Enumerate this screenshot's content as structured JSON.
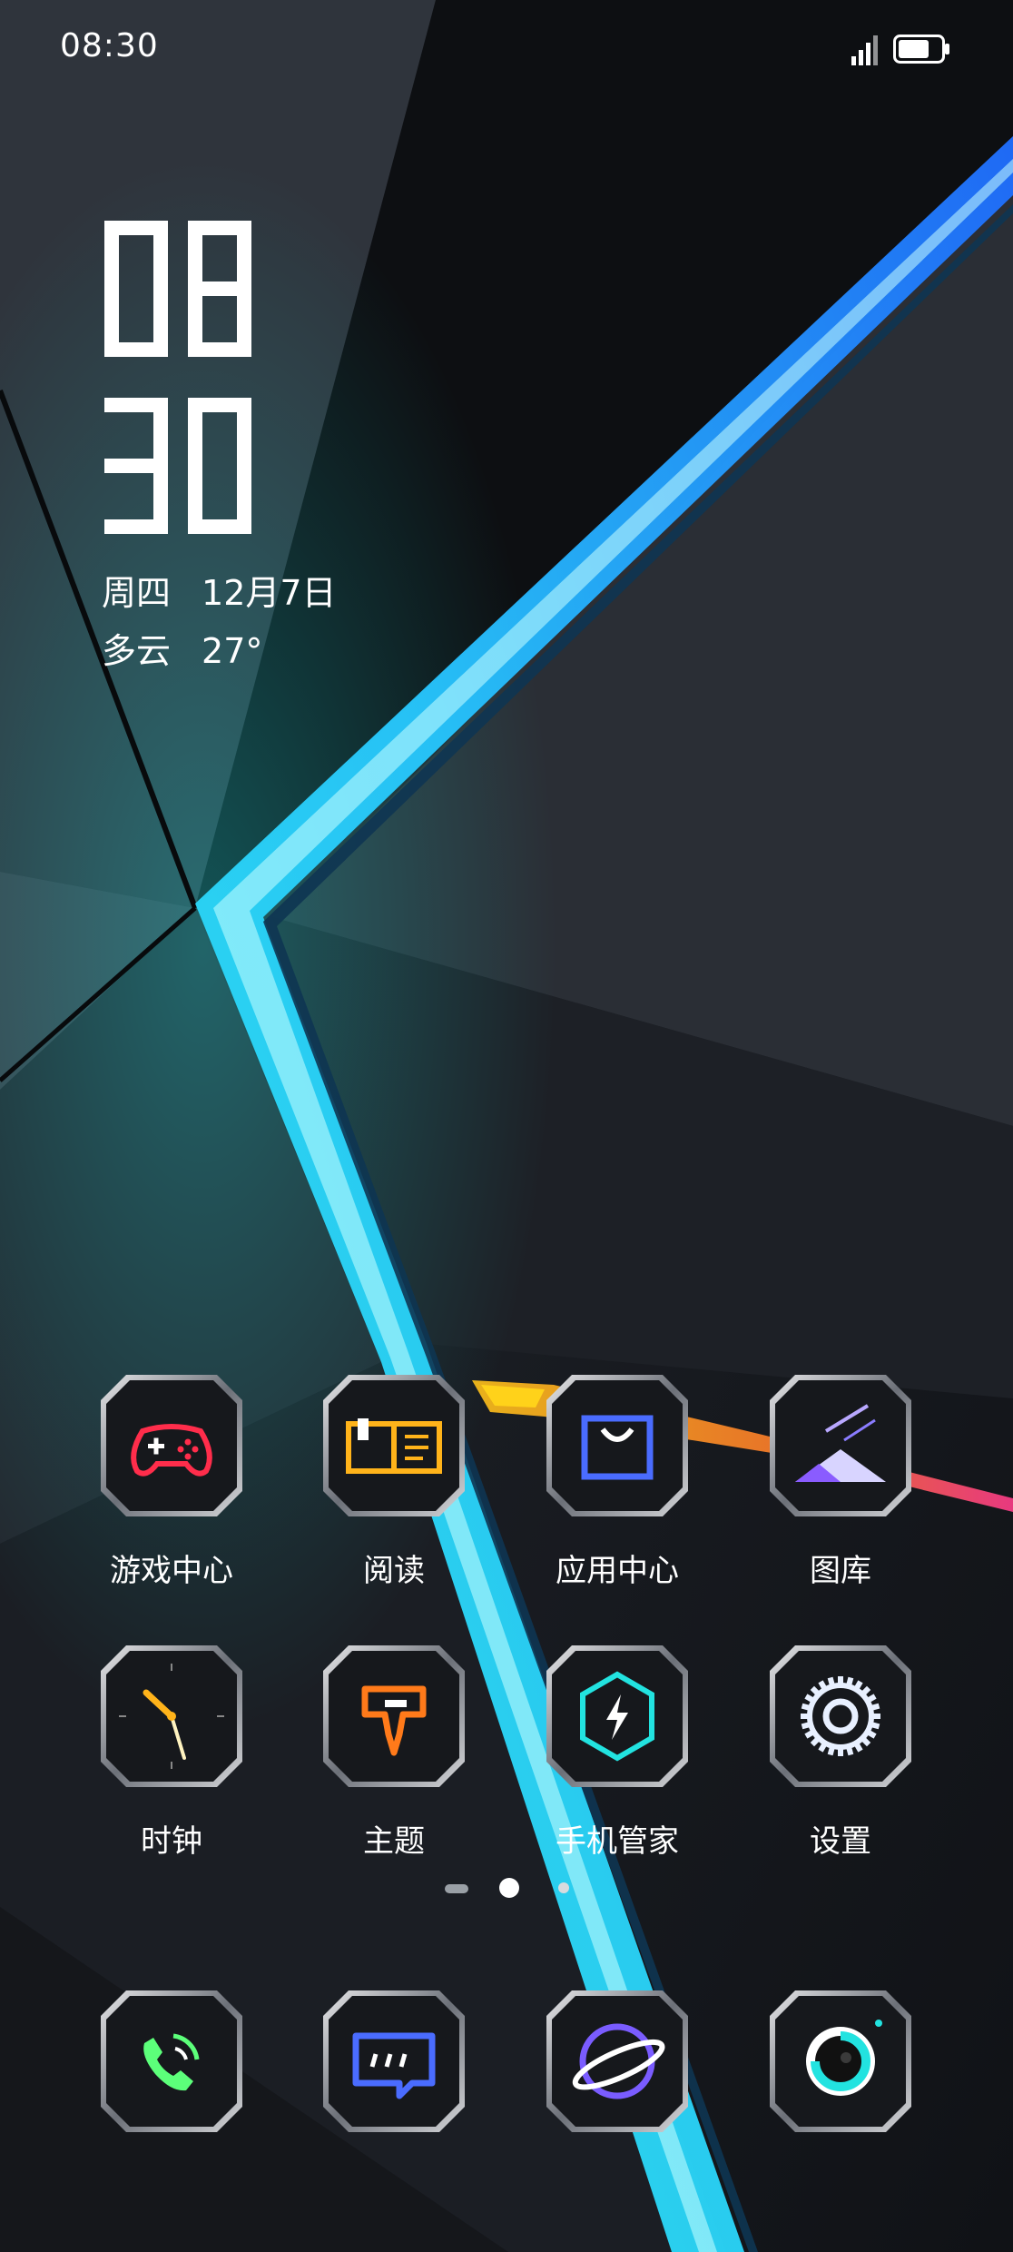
{
  "status_bar": {
    "time": "08:30",
    "signal_icon": "signal-bars-icon",
    "battery_icon": "battery-icon",
    "battery_level": 0.75
  },
  "lock_clock": {
    "hour": "08",
    "minute": "30",
    "weekday": "周四",
    "date": "12月7日",
    "weather": "多云",
    "temperature": "27°"
  },
  "apps": [
    {
      "label": "游戏中心",
      "icon": "gamepad-icon",
      "color": "#ff2d4b"
    },
    {
      "label": "阅读",
      "icon": "open-book-icon",
      "color": "#ffb31a"
    },
    {
      "label": "应用中心",
      "icon": "shopping-bag-icon",
      "color": "#4a6cff"
    },
    {
      "label": "图库",
      "icon": "mountain-photo-icon",
      "color": "#9a6bff"
    },
    {
      "label": "时钟",
      "icon": "clock-icon",
      "color": "#ffb31a"
    },
    {
      "label": "主题",
      "icon": "paint-brush-icon",
      "color": "#ff7a1a"
    },
    {
      "label": "手机管家",
      "icon": "shield-bolt-icon",
      "color": "#22e3e0"
    },
    {
      "label": "设置",
      "icon": "gear-icon",
      "color": "#ffffff"
    }
  ],
  "dock": [
    {
      "icon": "phone-icon",
      "color": "#5cff7a"
    },
    {
      "icon": "message-bubble-icon",
      "color": "#4a6cff"
    },
    {
      "icon": "planet-browser-icon",
      "color": "#7a5cff"
    },
    {
      "icon": "camera-lens-icon",
      "color": "#22e3e0"
    }
  ],
  "page_indicator": {
    "pages": 3,
    "current": 2
  }
}
